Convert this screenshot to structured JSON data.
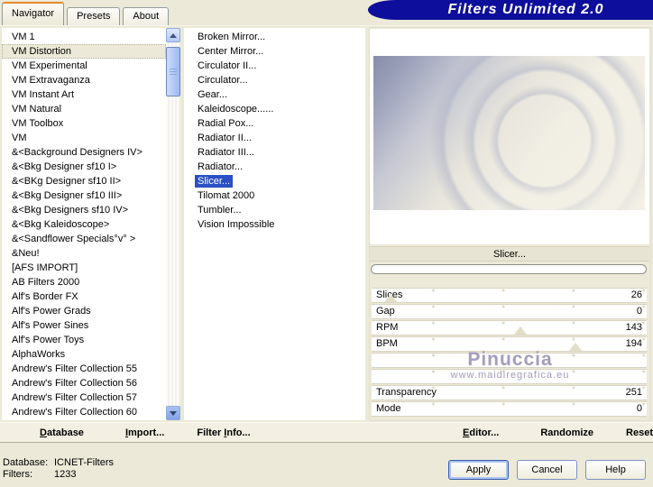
{
  "title": "Filters Unlimited 2.0",
  "tabs": [
    {
      "label": "Navigator",
      "active": true
    },
    {
      "label": "Presets"
    },
    {
      "label": "About"
    }
  ],
  "categories": {
    "items": [
      {
        "label": "VM 1"
      },
      {
        "label": "VM Distortion",
        "selected": true
      },
      {
        "label": "VM Experimental"
      },
      {
        "label": "VM Extravaganza"
      },
      {
        "label": "VM Instant Art"
      },
      {
        "label": "VM Natural"
      },
      {
        "label": "VM Toolbox"
      },
      {
        "label": "VM"
      },
      {
        "label": "&<Background Designers IV>"
      },
      {
        "label": "&<Bkg Designer sf10 I>"
      },
      {
        "label": "&<BKg Designer sf10 II>"
      },
      {
        "label": "&<Bkg Designer sf10 III>"
      },
      {
        "label": "&<Bkg Designers sf10 IV>"
      },
      {
        "label": "&<Bkg Kaleidoscope>"
      },
      {
        "label": "&<Sandflower Specials°v° >"
      },
      {
        "label": "&Neu!"
      },
      {
        "label": "[AFS IMPORT]"
      },
      {
        "label": "AB Filters 2000"
      },
      {
        "label": "Alf's Border FX"
      },
      {
        "label": "Alf's Power Grads"
      },
      {
        "label": "Alf's Power Sines"
      },
      {
        "label": "Alf's Power Toys"
      },
      {
        "label": "AlphaWorks"
      },
      {
        "label": "Andrew's Filter Collection 55"
      },
      {
        "label": "Andrew's Filter Collection 56"
      },
      {
        "label": "Andrew's Filter Collection 57"
      },
      {
        "label": "Andrew's Filter Collection 60"
      }
    ]
  },
  "filters": {
    "items": [
      {
        "label": "Broken Mirror..."
      },
      {
        "label": "Center Mirror..."
      },
      {
        "label": "Circulator II..."
      },
      {
        "label": "Circulator..."
      },
      {
        "label": "Gear..."
      },
      {
        "label": "Kaleidoscope......"
      },
      {
        "label": "Radial Pox..."
      },
      {
        "label": "Radiator II..."
      },
      {
        "label": "Radiator III..."
      },
      {
        "label": "Radiator..."
      },
      {
        "label": "Slicer...",
        "selected": true
      },
      {
        "label": "Tilomat 2000"
      },
      {
        "label": "Tumbler..."
      },
      {
        "label": "Vision Impossible"
      }
    ]
  },
  "preview": {
    "filter_label": "Slicer...",
    "progress_pct": 0
  },
  "sliders": [
    {
      "label": "Slices",
      "value": "26",
      "thumb_pct": 7
    },
    {
      "label": "Gap",
      "value": "0",
      "thumb_pct": null
    },
    {
      "label": "RPM",
      "value": "143",
      "thumb_pct": 54
    },
    {
      "label": "BPM",
      "value": "194",
      "thumb_pct": 74
    },
    {
      "label": "",
      "value": "",
      "thumb_pct": null
    },
    {
      "label": "",
      "value": "",
      "thumb_pct": null
    },
    {
      "label": "Transparency",
      "value": "251",
      "thumb_pct": null
    },
    {
      "label": "Mode",
      "value": "0",
      "thumb_pct": null
    }
  ],
  "watermark": {
    "name": "Pinuccia",
    "url": "www.maidiregrafica.eu"
  },
  "toolbar": [
    {
      "pre": "",
      "key": "D",
      "post": "atabase"
    },
    {
      "pre": "",
      "key": "I",
      "post": "mport..."
    },
    {
      "pre": "Filter ",
      "key": "I",
      "post": "nfo..."
    },
    {
      "pre": "",
      "key": "E",
      "post": "ditor..."
    },
    {
      "pre": "Randomize",
      "key": "",
      "post": ""
    },
    {
      "pre": "Reset",
      "key": "",
      "post": ""
    }
  ],
  "status": {
    "database_label": "Database:",
    "database_value": "ICNET-Filters",
    "filters_label": "Filters:",
    "filters_value": "1233"
  },
  "actions": [
    {
      "label": "Apply",
      "focused": true
    },
    {
      "label": "Cancel"
    },
    {
      "label": "Help"
    }
  ],
  "colors": {
    "title_blue": "#0e0e9c",
    "selection_blue": "#2b50c5",
    "dialog_beige": "#ece9d8",
    "tab_accent_orange": "#e68b2c",
    "watermark_purple": "#a49dbd"
  }
}
